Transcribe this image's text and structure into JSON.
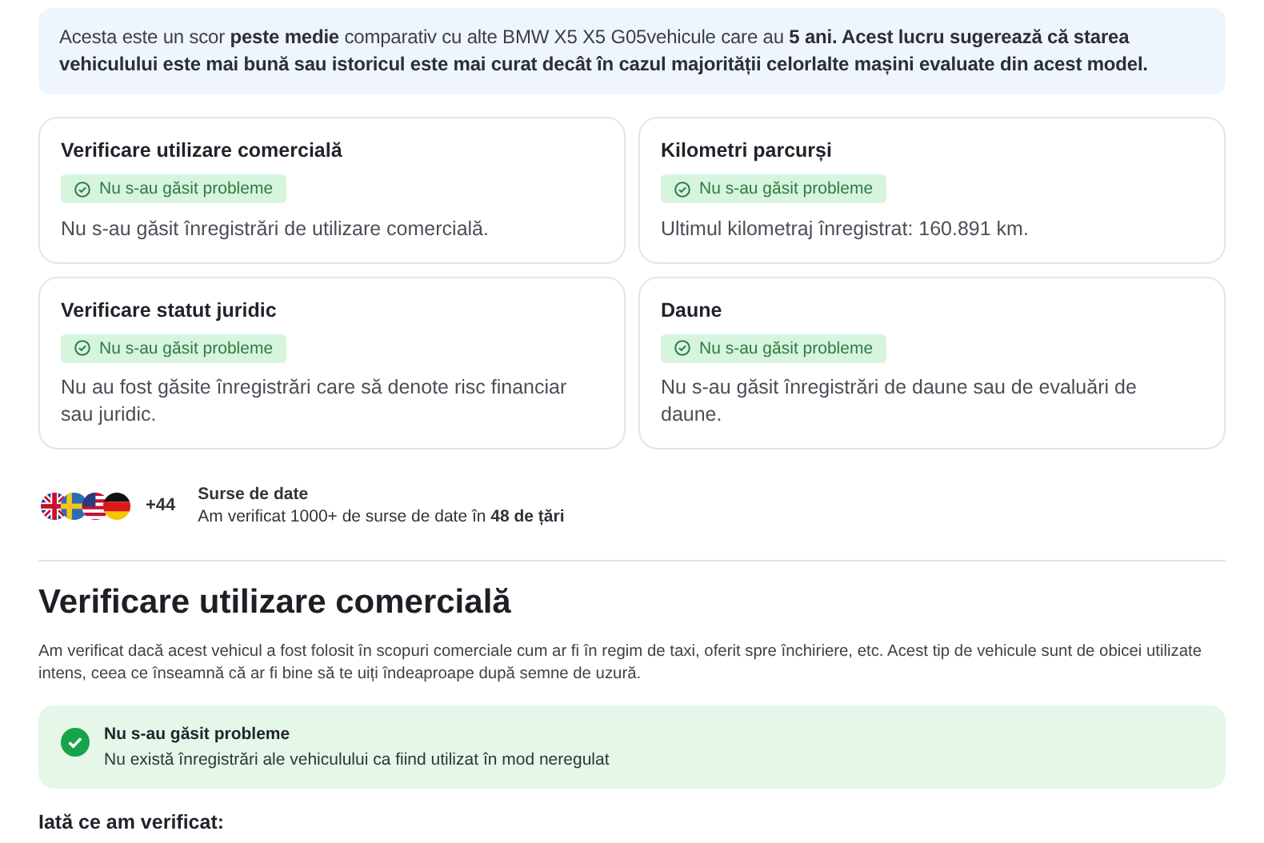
{
  "summary": {
    "text": "Acesta este un scor **peste medie** comparativ cu alte BMW X5 X5 G05vehicule care au **5 ani. Acest lucru sugerează că starea vehiculului este mai bună sau istoricul este mai curat decât în cazul majorității celorlalte mașini evaluate din acest model.**"
  },
  "checks": [
    {
      "title": "Verificare utilizare comercială",
      "status": {
        "kind": "ok",
        "label": "Nu s-au găsit probleme"
      },
      "description": "Nu s-au găsit înregistrări de utilizare comercială."
    },
    {
      "title": "Kilometri parcurși",
      "status": {
        "kind": "ok",
        "label": "Nu s-au găsit probleme"
      },
      "description": "Ultimul kilometraj înregistrat: 160.891 km."
    },
    {
      "title": "Verificare statut juridic",
      "status": {
        "kind": "ok",
        "label": "Nu s-au găsit probleme"
      },
      "description": "Nu au fost găsite înregistrări care să denote risc financiar sau juridic."
    },
    {
      "title": "Daune",
      "status": {
        "kind": "ok",
        "label": "Nu s-au găsit probleme"
      },
      "description": "Nu s-au găsit înregistrări de daune sau de evaluări de daune."
    }
  ],
  "sources": {
    "extra_count": "+44",
    "title": "Surse de date",
    "text": "Am verificat 1000+ de surse de date în **48 de țări**"
  },
  "section": {
    "heading": "Verificare utilizare comercială",
    "intro": "Am verificat dacă acest vehicul a fost folosit în scopuri comerciale cum ar fi în regim de taxi, oferit spre închiriere, etc. Acest tip de vehicule sunt de obicei utilizate intens, ceea ce înseamnă că ar fi bine să te uiți îndeaproape după semne de uzură.",
    "result": {
      "kind": "ok",
      "title": "Nu s-au găsit probleme",
      "text": "Nu există înregistrări ale vehiculului ca fiind utilizat în mod neregulat"
    },
    "subheading": "Iată ce am verificat:"
  }
}
